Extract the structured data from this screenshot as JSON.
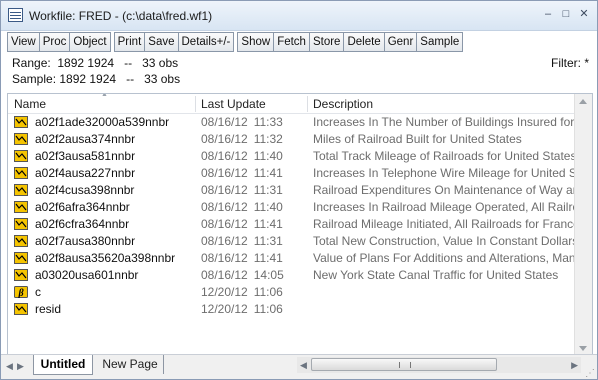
{
  "window": {
    "title": "Workfile: FRED - (c:\\data\\fred.wf1)",
    "controls": {
      "minimize": "–",
      "maximize": "□",
      "close": "✕"
    }
  },
  "toolbar": {
    "buttons": [
      "View",
      "Proc",
      "Object",
      "Print",
      "Save",
      "Details+/-",
      "Show",
      "Fetch",
      "Store",
      "Delete",
      "Genr",
      "Sample"
    ]
  },
  "info": {
    "range": "Range:  1892 1924   --   33 obs",
    "sample": "Sample: 1892 1924   --   33 obs",
    "filter": "Filter: *"
  },
  "columns": {
    "name": "Name",
    "last_update": "Last Update",
    "description": "Description"
  },
  "rows": [
    {
      "icon": "series-icon",
      "name": "a02f1ade32000a539nnbr",
      "date": "08/16/12",
      "time": "11:33",
      "description": "Increases In The Number of Buildings Insured for E"
    },
    {
      "icon": "series-icon",
      "name": "a02f2ausa374nnbr",
      "date": "08/16/12",
      "time": "11:32",
      "description": "Miles of Railroad Built for United States"
    },
    {
      "icon": "series-icon",
      "name": "a02f3ausa581nnbr",
      "date": "08/16/12",
      "time": "11:40",
      "description": "Total Track Mileage of Railroads for United States"
    },
    {
      "icon": "series-icon",
      "name": "a02f4ausa227nnbr",
      "date": "08/16/12",
      "time": "11:41",
      "description": "Increases In Telephone Wire Mileage for United Sta"
    },
    {
      "icon": "series-icon",
      "name": "a02f4cusa398nnbr",
      "date": "08/16/12",
      "time": "11:31",
      "description": "Railroad Expenditures On Maintenance of Way and"
    },
    {
      "icon": "series-icon",
      "name": "a02f6afra364nnbr",
      "date": "08/16/12",
      "time": "11:40",
      "description": "Increases In Railroad Mileage Operated, All Railroa"
    },
    {
      "icon": "series-icon",
      "name": "a02f6cfra364nnbr",
      "date": "08/16/12",
      "time": "11:41",
      "description": "Railroad Mileage Initiated, All Railroads for France"
    },
    {
      "icon": "series-icon",
      "name": "a02f7ausa380nnbr",
      "date": "08/16/12",
      "time": "11:31",
      "description": "Total New Construction, Value In Constant Dollars f"
    },
    {
      "icon": "series-icon",
      "name": "a02f8ausa35620a398nnbr",
      "date": "08/16/12",
      "time": "11:41",
      "description": "Value of Plans For Additions and Alterations, Manha"
    },
    {
      "icon": "series-icon",
      "name": "a03020usa601nnbr",
      "date": "08/16/12",
      "time": "14:05",
      "description": "New York State Canal Traffic for United States"
    },
    {
      "icon": "coef-icon",
      "name": "c",
      "date": "12/20/12",
      "time": "11:06",
      "description": ""
    },
    {
      "icon": "series-icon",
      "name": "resid",
      "date": "12/20/12",
      "time": "11:06",
      "description": ""
    }
  ],
  "tabs": [
    {
      "label": "Untitled",
      "active": true
    },
    {
      "label": "New Page",
      "active": false
    }
  ],
  "colors": {
    "series_icon_fill": "#f5c400",
    "coef_icon_fill": "#f5c400",
    "titlebar": "#dde8f5"
  }
}
